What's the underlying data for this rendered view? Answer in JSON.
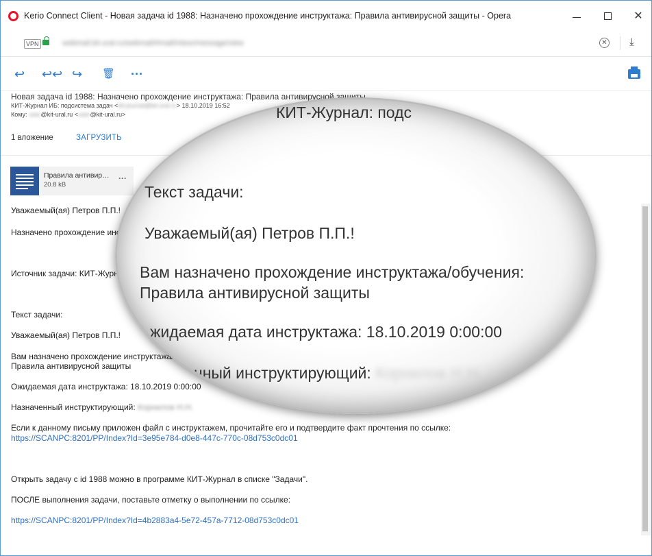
{
  "window": {
    "title": "Kerio Connect Client - Новая задача id 1988: Назначено прохождение инструктажа: Правила антивирусной защиты - Opera",
    "vpn_label": "VPN",
    "url": "webmail.kit-ural.ru/webmail/#mail/Inbox/message/view"
  },
  "toolbar": {
    "reply_icon": "reply-icon",
    "reply_all_icon": "reply-all-icon",
    "forward_icon": "forward-icon",
    "delete_icon": "trash-icon",
    "more_label": "···",
    "print_icon": "print-icon",
    "accent_color": "#2f7bd0"
  },
  "message": {
    "subject": "Новая задача id 1988: Назначено прохождение инструктажа: Правила антивирусной защиты",
    "from_prefix": "КИТ-Журнал ИБ: подсистема задач <",
    "from_hidden": "kit-journal@kit-ural.ru",
    "from_suffix": "> 18.10.2019 16:52",
    "to_prefix": "Кому:",
    "to_hidden_1": "user",
    "to_mid": "@kit-ural.ru <",
    "to_hidden_2": "user",
    "to_suffix": "@kit-ural.ru>"
  },
  "attachments": {
    "count_label": "1 вложение",
    "download_label": "ЗАГРУЗИТЬ",
    "file_name": "Правила антивир…",
    "file_size": "20.8 kB",
    "more_label": "···"
  },
  "body": {
    "greeting": "Уважаемый(ая) Петров П.П.!",
    "assigned": "Назначено прохождение инструктажа: Правила антивирусной защиты",
    "source": "Источник задачи: КИТ-Журнал ИБ",
    "task_text_label": "Текст задачи:",
    "task_greeting": " Уважаемый(ая)  Петров П.П.!",
    "assigned_full_1": "Вам назначено прохождение инструктажа/обучения:",
    "assigned_full_2": "Правила антивирусной защиты",
    "expected_date": "Ожидаемая дата инструктажа: 18.10.2019 0:00:00",
    "instructor_label": "Назначенный инструктирующий:",
    "instructor_name": "Корнилов Н.Н.",
    "attached_note": "Если к данному письму приложен файл с инструктажем, прочитайте его и подтвердите факт прочтения по ссылке:",
    "link_1": "https://SCANPC:8201/PP/Index?Id=3e95e784-d0e8-447c-770c-08d753c0dc01",
    "open_task": "Открыть задачу с id 1988 можно в программе КИТ-Журнал в списке \"Задачи\".",
    "after_note": "ПОСЛЕ выполнения задачи, поставьте отметку о выполнении по ссылке:",
    "link_2": "https://SCANPC:8201/PP/Index?Id=4b2883a4-5e72-457a-7712-08d753c0dc01"
  },
  "magnifier": {
    "top_fragment": "КИТ-Журнал: подс",
    "task_text_label": "Текст задачи:",
    "greeting": "Уважаемый(ая)  Петров П.П.!",
    "assigned_1": "Вам назначено прохождение инструктажа/обучения:",
    "assigned_2": "Правила антивирусной защиты",
    "expected_date": "жидаемая дата инструктажа: 18.10.2019 0:00:00",
    "instructor_fragment": "нный инструктирующий:",
    "instructor_hidden": "Корнилов Н.Н."
  },
  "colors": {
    "link": "#2f6fc0",
    "opera_red": "#e3132a",
    "word_blue": "#2b579a"
  }
}
